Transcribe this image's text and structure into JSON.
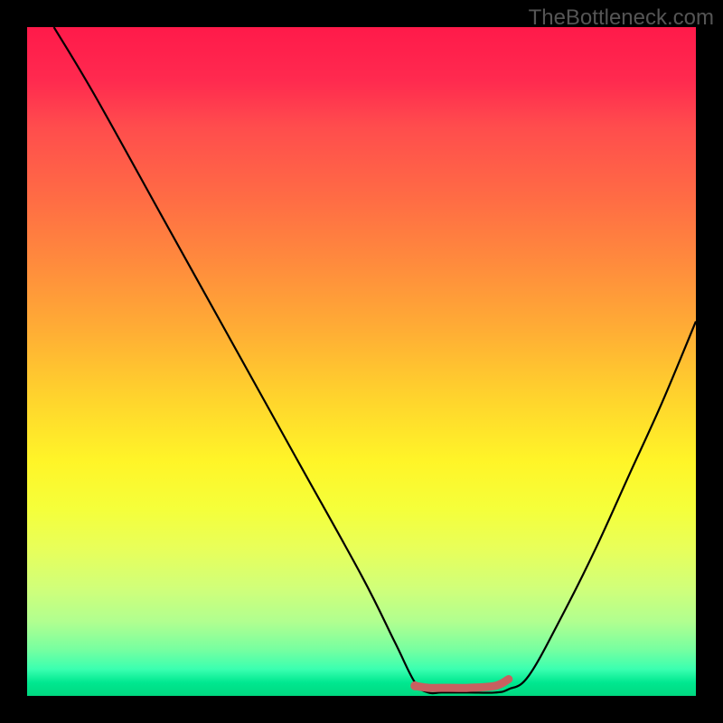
{
  "watermark": "TheBottleneck.com",
  "chart_data": {
    "type": "line",
    "title": "",
    "xlabel": "",
    "ylabel": "",
    "xlim": [
      0,
      100
    ],
    "ylim": [
      0,
      100
    ],
    "series": [
      {
        "name": "bottleneck-curve",
        "x": [
          4,
          10,
          20,
          30,
          40,
          50,
          55,
          58,
          60,
          62,
          66,
          70,
          72,
          75,
          80,
          85,
          90,
          95,
          100
        ],
        "values": [
          100,
          90,
          72,
          54,
          36,
          18,
          8,
          2,
          0.5,
          0.5,
          0.5,
          0.5,
          1,
          3,
          12,
          22,
          33,
          44,
          56
        ]
      },
      {
        "name": "highlight-segment",
        "x": [
          58,
          60,
          62,
          66,
          70,
          72
        ],
        "values": [
          1.5,
          1.2,
          1.2,
          1.2,
          1.5,
          2.5
        ]
      }
    ],
    "highlight_color": "#c86060",
    "curve_color": "#000000"
  },
  "accessibility": {
    "chart_desc": "Bottleneck curve chart with rainbow gradient background"
  }
}
